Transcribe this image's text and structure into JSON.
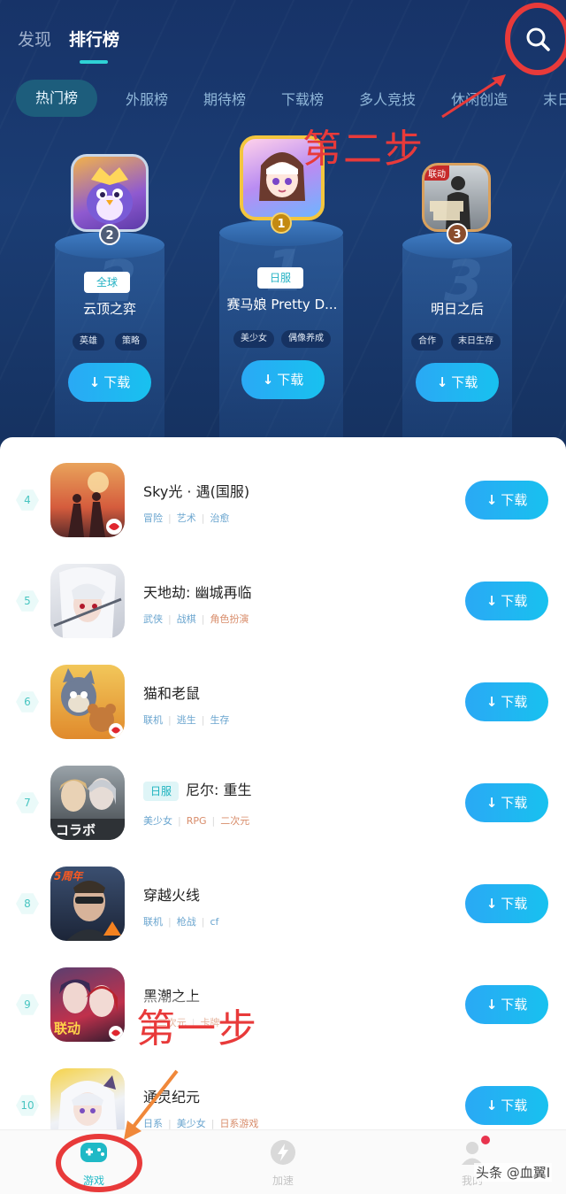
{
  "header": {
    "tabs": [
      {
        "label": "发现",
        "active": false
      },
      {
        "label": "排行榜",
        "active": true
      }
    ]
  },
  "categories": [
    {
      "label": "热门榜",
      "active": true
    },
    {
      "label": "外服榜"
    },
    {
      "label": "期待榜"
    },
    {
      "label": "下载榜"
    },
    {
      "label": "多人竞技"
    },
    {
      "label": "休闲创造"
    },
    {
      "label": "末日求"
    }
  ],
  "podium": [
    {
      "rank": "2",
      "badge": "全球",
      "name": "云顶之弈",
      "tags": [
        "英雄",
        "策略"
      ],
      "download": "下载",
      "pedestal_number": "2"
    },
    {
      "rank": "1",
      "badge": "日服",
      "name": "赛马娘 Pretty D...",
      "tags": [
        "美少女",
        "偶像养成"
      ],
      "download": "下载",
      "pedestal_number": "1"
    },
    {
      "rank": "3",
      "badge": "",
      "name": "明日之后",
      "tags": [
        "合作",
        "末日生存"
      ],
      "download": "下载",
      "pedestal_number": "3",
      "icon_text": "联动"
    }
  ],
  "list": [
    {
      "rank": "4",
      "name": "Sky光 · 遇(国服)",
      "badge": "",
      "tags": [
        "冒险",
        "艺术",
        "治愈"
      ],
      "download": "下载"
    },
    {
      "rank": "5",
      "name": "天地劫: 幽城再临",
      "badge": "",
      "tags": [
        "武侠",
        "战棋",
        "角色扮演"
      ],
      "download": "下载"
    },
    {
      "rank": "6",
      "name": "猫和老鼠",
      "badge": "",
      "tags": [
        "联机",
        "逃生",
        "生存"
      ],
      "download": "下载"
    },
    {
      "rank": "7",
      "name": "尼尔: 重生",
      "badge": "日服",
      "tags": [
        "美少女",
        "RPG",
        "二次元"
      ],
      "download": "下载"
    },
    {
      "rank": "8",
      "name": "穿越火线",
      "badge": "",
      "tags": [
        "联机",
        "枪战",
        "cf"
      ],
      "download": "下载"
    },
    {
      "rank": "9",
      "name": "黑潮之上",
      "badge": "",
      "tags": [
        "",
        "二次元",
        "卡牌"
      ],
      "download": "下载"
    },
    {
      "rank": "10",
      "name": "通灵纪元",
      "badge": "",
      "tags": [
        "日系",
        "美少女",
        "日系游戏"
      ],
      "download": "下载"
    }
  ],
  "icon_texts": {
    "nier": "コラボ",
    "cf": "5周年",
    "hc": "联动"
  },
  "annotations": {
    "step1": "第一步",
    "step2": "第二步",
    "color": "#e83a3a"
  },
  "nav": [
    {
      "label": "游戏",
      "active": true,
      "icon": "gamepad-icon"
    },
    {
      "label": "加速",
      "active": false,
      "icon": "lightning-icon"
    },
    {
      "label": "我的",
      "active": false,
      "icon": "user-icon"
    }
  ],
  "watermark": "头条 @血翼I",
  "colors": {
    "accent": "#1fb9c6",
    "download": "#18b3f2",
    "dark_bg": "#1b3d74"
  }
}
